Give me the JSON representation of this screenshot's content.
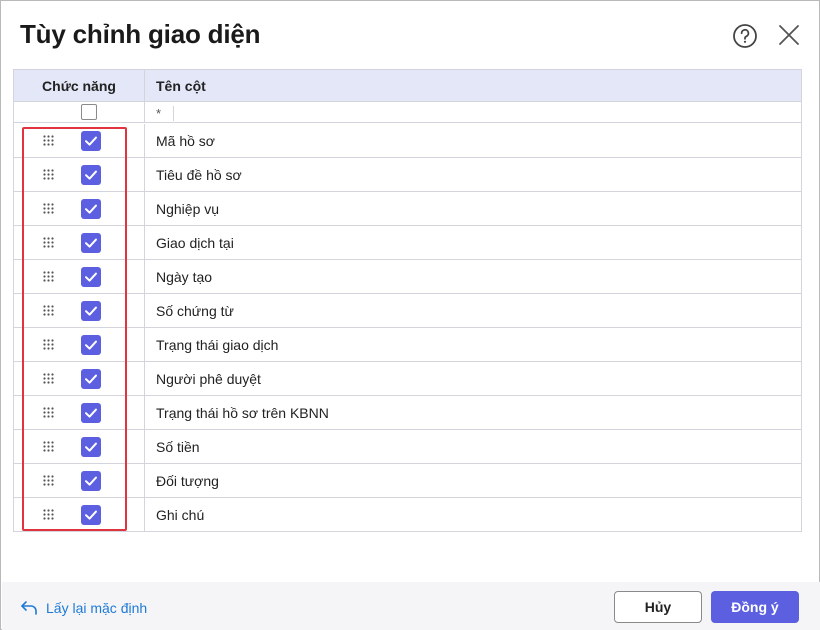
{
  "dialog": {
    "title": "Tùy chỉnh giao diện",
    "help_icon": "help-circle-icon",
    "close_icon": "close-icon"
  },
  "grid": {
    "header": {
      "function": "Chức năng",
      "column_name": "Tên cột"
    },
    "filter": {
      "placeholder": "*",
      "select_all_checked": false
    },
    "rows": [
      {
        "label": "Mã hồ sơ",
        "checked": true
      },
      {
        "label": "Tiêu đề hồ sơ",
        "checked": true
      },
      {
        "label": "Nghiệp vụ",
        "checked": true
      },
      {
        "label": "Giao dịch tại",
        "checked": true
      },
      {
        "label": "Ngày tạo",
        "checked": true
      },
      {
        "label": "Số chứng từ",
        "checked": true
      },
      {
        "label": "Trạng thái giao dịch",
        "checked": true
      },
      {
        "label": "Người phê duyệt",
        "checked": true
      },
      {
        "label": "Trạng thái hồ sơ trên KBNN",
        "checked": true
      },
      {
        "label": "Số tiền",
        "checked": true
      },
      {
        "label": "Đối tượng",
        "checked": true
      },
      {
        "label": "Ghi chú",
        "checked": true
      }
    ]
  },
  "footer": {
    "reset_label": "Lấy lại mặc định",
    "cancel_label": "Hủy",
    "ok_label": "Đồng ý"
  },
  "colors": {
    "accent": "#5b5fe0",
    "header_bg": "#e4e7f8",
    "link": "#1f7ad6",
    "highlight": "#e0343f"
  }
}
